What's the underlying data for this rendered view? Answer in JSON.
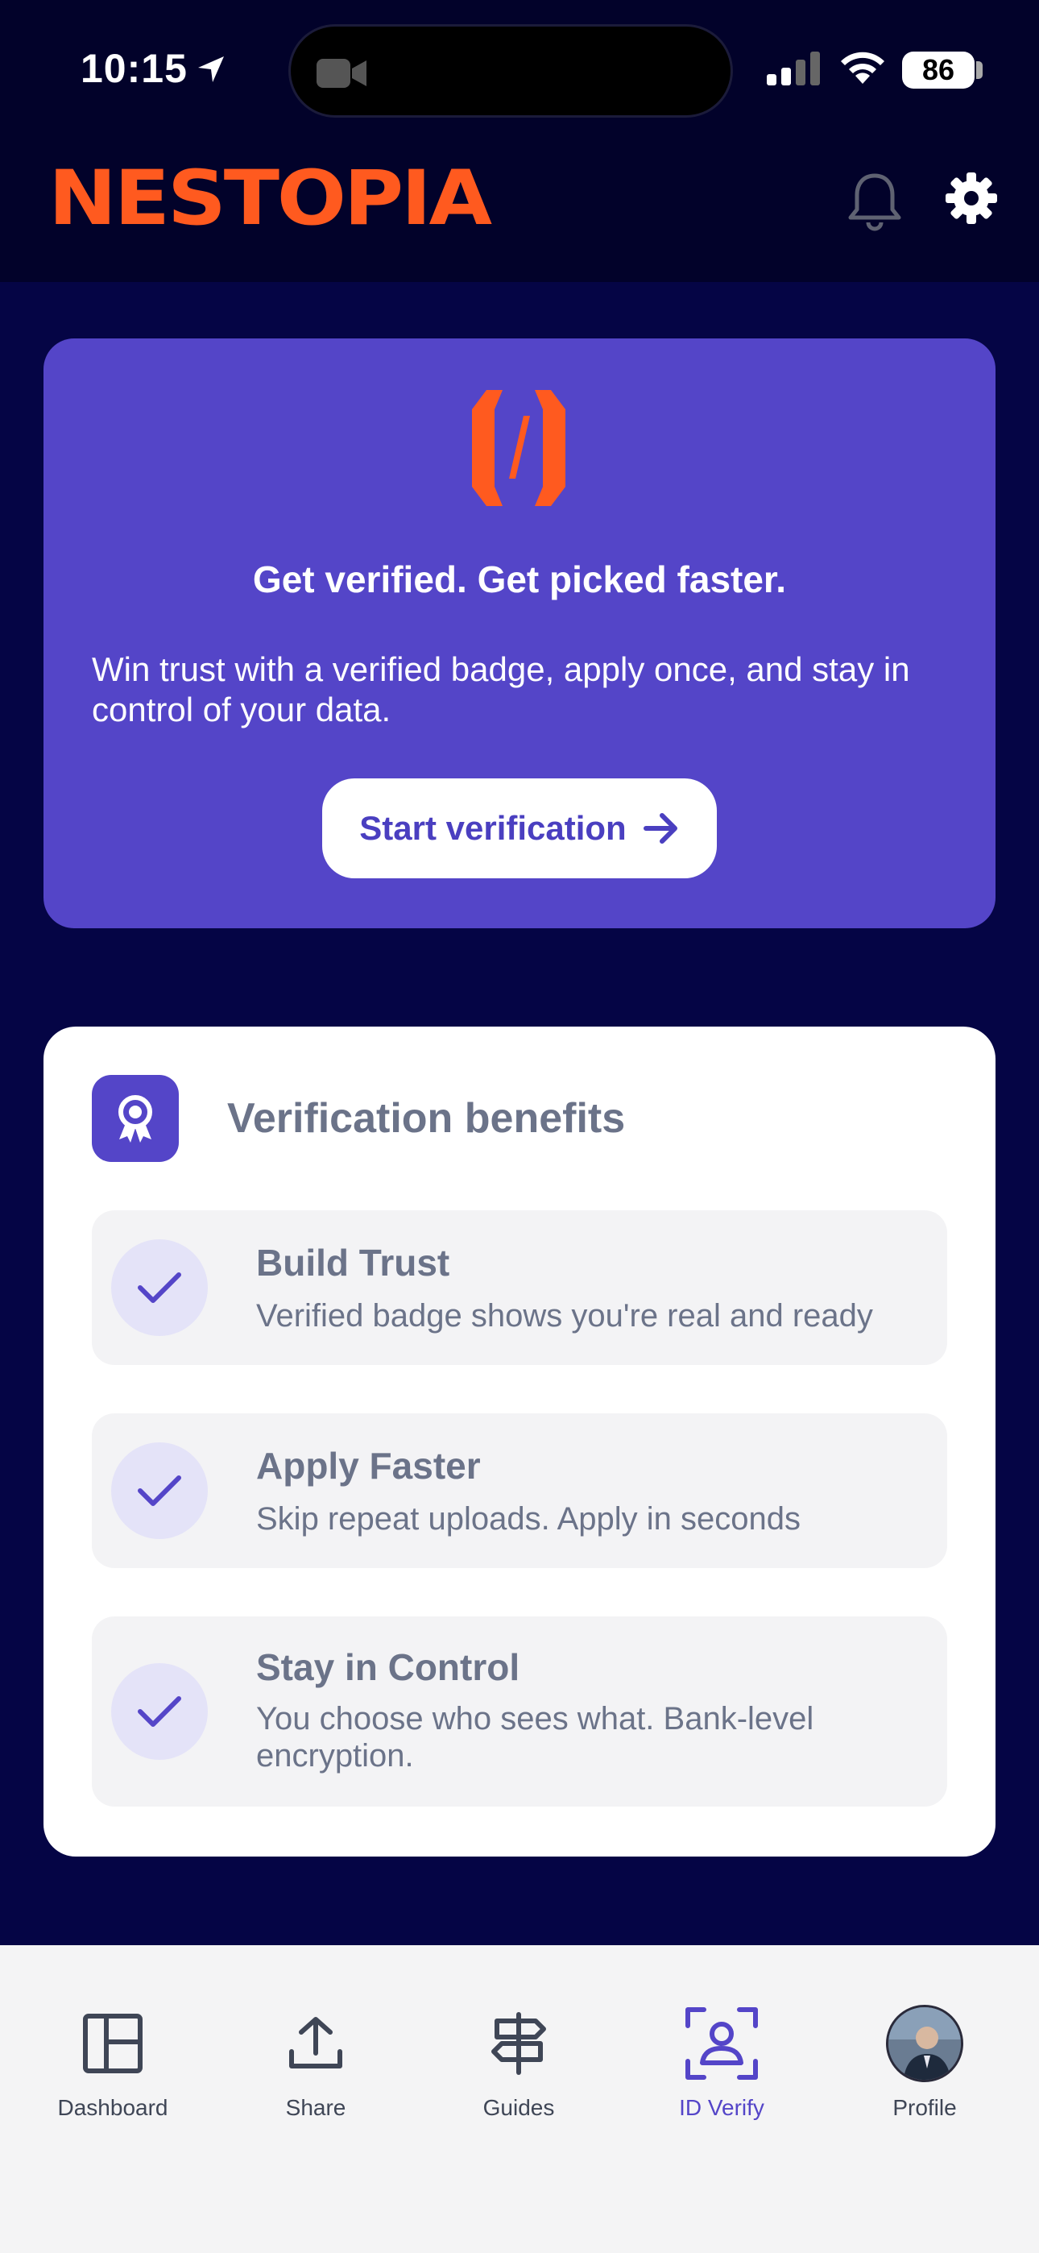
{
  "status_bar": {
    "time": "10:15",
    "battery": "86"
  },
  "header": {
    "brand": "NESTOPIA"
  },
  "hero": {
    "title": "Get verified. Get picked faster.",
    "description": "Win trust with a verified badge, apply once, and stay in control of your data.",
    "button_label": "Start verification"
  },
  "benefits": {
    "title": "Verification benefits",
    "items": [
      {
        "name": "Build Trust",
        "text": "Verified badge shows you're real and ready"
      },
      {
        "name": "Apply Faster",
        "text": "Skip repeat uploads. Apply in seconds"
      },
      {
        "name": "Stay in Control",
        "text": "You choose who sees what. Bank-level encryption."
      }
    ]
  },
  "tabs": [
    {
      "label": "Dashboard",
      "icon": "dashboard-icon"
    },
    {
      "label": "Share",
      "icon": "upload-icon"
    },
    {
      "label": "Guides",
      "icon": "signpost-icon"
    },
    {
      "label": "ID Verify",
      "icon": "id-scan-icon",
      "active": true
    },
    {
      "label": "Profile",
      "icon": "avatar"
    }
  ],
  "colors": {
    "background": "#050545",
    "brand": "#ff5a1f",
    "accent": "#5445c8",
    "card": "#ffffff"
  }
}
